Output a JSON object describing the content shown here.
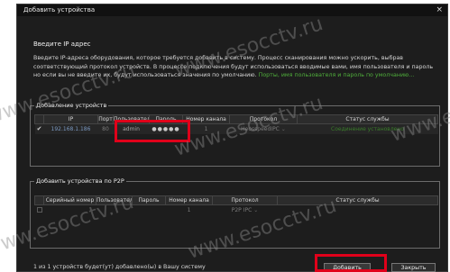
{
  "window": {
    "title": "Добавить устройства",
    "close_glyph": "×"
  },
  "intro": {
    "heading": "Введите IP адрес",
    "text": "Введите IP-адреса оборудования, которое требуется добавить в систему. Процесс сканирования можно ускорить, выбрав соответствующий протокол устройств. В процессе подключения будут использоваться вводимые вами, имя пользователя и пароль но если вы не введите их, будут использоваться значения по умолчанию.",
    "link": "Порты, имя пользователя и пароль по умолчанию..."
  },
  "ip_group": {
    "label": "Добавление устройств",
    "columns": [
      "IP",
      "Порт",
      "Пользователь",
      "Пароль",
      "Номер канала",
      "Протокол",
      "Статус службы"
    ],
    "row": {
      "checked": "✔",
      "ip": "192.168.1.186",
      "port": "80",
      "user": "admin",
      "password": "●●●●●",
      "channel": "1",
      "protocol": "HeosspeedIPC",
      "protocol_arrow": "⌄",
      "status": "Соединение установлено"
    }
  },
  "p2p_group": {
    "label": "Добавить устройства  по P2P",
    "columns": [
      "Серийный номер",
      "Пользователь",
      "Пароль",
      "Номер канала",
      "Протокол",
      "Статус службы"
    ],
    "row": {
      "serial": "",
      "user": "",
      "password": "",
      "channel": "1",
      "protocol": "P2P IPC",
      "protocol_arrow": "⌄",
      "status": ""
    }
  },
  "footer": {
    "status": "1 из 1 устройств будет(ут) добавлено(ы) в Вашу систему",
    "add_button": "Добавить",
    "close_button": "Закрыть"
  },
  "watermark": "www.esocctv.ru",
  "colors": {
    "background": "#1d1d1d",
    "highlight": "#e0001a",
    "link_green": "#4fae3b",
    "ip_blue": "#7a98c0"
  }
}
